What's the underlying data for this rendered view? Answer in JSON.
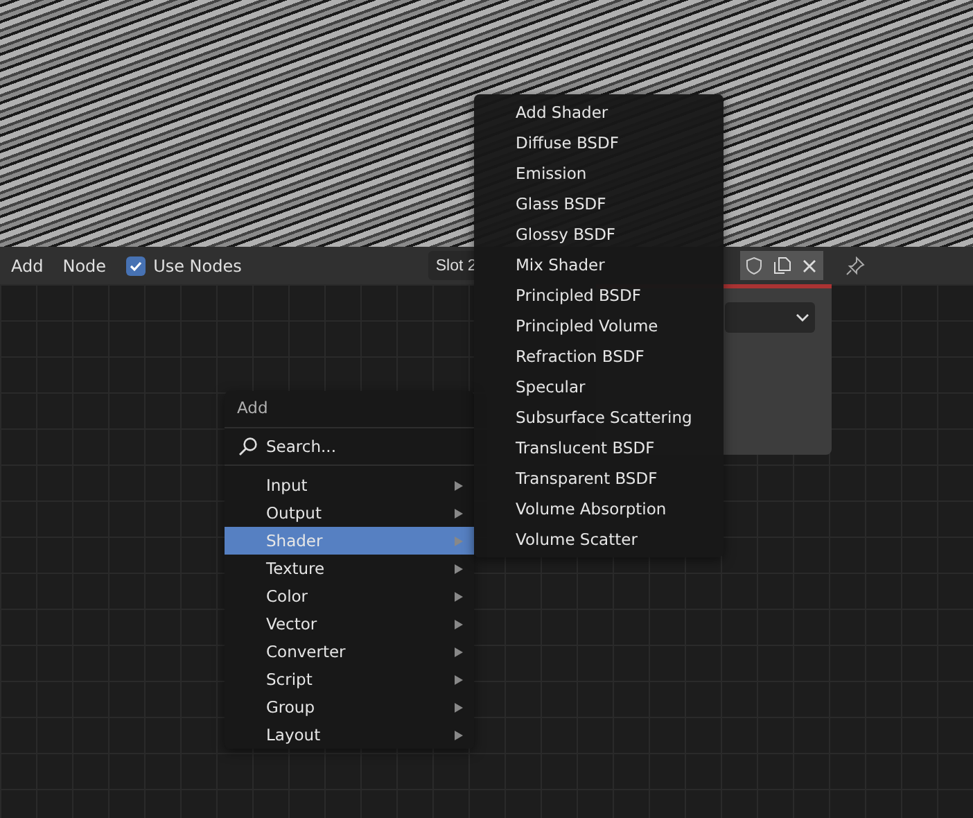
{
  "header": {
    "menus": [
      "Add",
      "Node"
    ],
    "use_nodes": {
      "label": "Use Nodes",
      "checked": true
    },
    "slot": "Slot 2"
  },
  "add_menu": {
    "title": "Add",
    "search": {
      "placeholder": "Search..."
    },
    "items": [
      {
        "label": "Input",
        "selected": false,
        "submenu": true
      },
      {
        "label": "Output",
        "selected": false,
        "submenu": true
      },
      {
        "label": "Shader",
        "selected": true,
        "submenu": true
      },
      {
        "label": "Texture",
        "selected": false,
        "submenu": true
      },
      {
        "label": "Color",
        "selected": false,
        "submenu": true
      },
      {
        "label": "Vector",
        "selected": false,
        "submenu": true
      },
      {
        "label": "Converter",
        "selected": false,
        "submenu": true
      },
      {
        "label": "Script",
        "selected": false,
        "submenu": true
      },
      {
        "label": "Group",
        "selected": false,
        "submenu": true
      },
      {
        "label": "Layout",
        "selected": false,
        "submenu": true
      }
    ]
  },
  "shader_menu": {
    "items": [
      "Add Shader",
      "Diffuse BSDF",
      "Emission",
      "Glass BSDF",
      "Glossy BSDF",
      "Mix Shader",
      "Principled BSDF",
      "Principled Volume",
      "Refraction BSDF",
      "Specular",
      "Subsurface Scattering",
      "Translucent BSDF",
      "Transparent BSDF",
      "Volume Absorption",
      "Volume Scatter"
    ]
  }
}
